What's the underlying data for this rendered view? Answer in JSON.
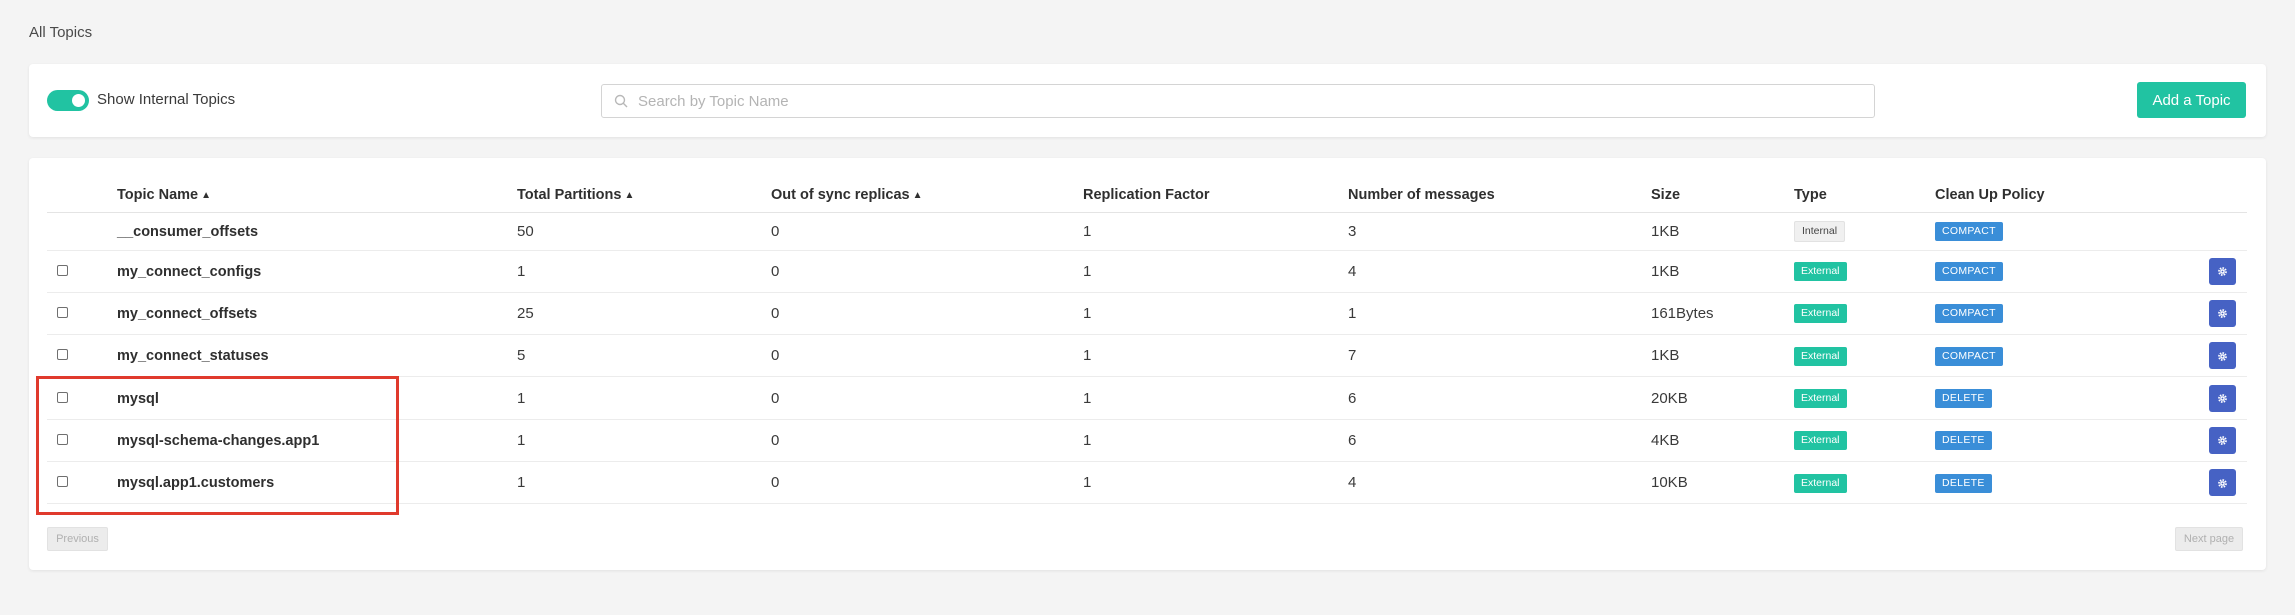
{
  "breadcrumb": "All Topics",
  "toolbar": {
    "toggle_label": "Show Internal Topics",
    "toggle_on": true,
    "search_placeholder": "Search by Topic Name",
    "search_value": "",
    "add_button_label": "Add a Topic"
  },
  "table": {
    "headers": {
      "topic_name": "Topic Name",
      "total_partitions": "Total Partitions",
      "out_of_sync": "Out of sync replicas",
      "replication_factor": "Replication Factor",
      "number_of_messages": "Number of messages",
      "size": "Size",
      "type": "Type",
      "clean_up_policy": "Clean Up Policy"
    },
    "rows": [
      {
        "name": "__consumer_offsets",
        "partitions": "50",
        "out_of_sync": "0",
        "replication_factor": "1",
        "messages": "3",
        "size": "1KB",
        "type": "Internal",
        "policy": "COMPACT"
      },
      {
        "name": "my_connect_configs",
        "partitions": "1",
        "out_of_sync": "0",
        "replication_factor": "1",
        "messages": "4",
        "size": "1KB",
        "type": "External",
        "policy": "COMPACT"
      },
      {
        "name": "my_connect_offsets",
        "partitions": "25",
        "out_of_sync": "0",
        "replication_factor": "1",
        "messages": "1",
        "size": "161Bytes",
        "type": "External",
        "policy": "COMPACT"
      },
      {
        "name": "my_connect_statuses",
        "partitions": "5",
        "out_of_sync": "0",
        "replication_factor": "1",
        "messages": "7",
        "size": "1KB",
        "type": "External",
        "policy": "COMPACT"
      },
      {
        "name": "mysql",
        "partitions": "1",
        "out_of_sync": "0",
        "replication_factor": "1",
        "messages": "6",
        "size": "20KB",
        "type": "External",
        "policy": "DELETE"
      },
      {
        "name": "mysql-schema-changes.app1",
        "partitions": "1",
        "out_of_sync": "0",
        "replication_factor": "1",
        "messages": "6",
        "size": "4KB",
        "type": "External",
        "policy": "DELETE"
      },
      {
        "name": "mysql.app1.customers",
        "partitions": "1",
        "out_of_sync": "0",
        "replication_factor": "1",
        "messages": "4",
        "size": "10KB",
        "type": "External",
        "policy": "DELETE"
      }
    ]
  },
  "pagination": {
    "previous_label": "Previous",
    "next_label": "Next page"
  },
  "colors": {
    "accent": "#21c3a2",
    "policy_badge": "#3a8ed8",
    "settings_button": "#4662c4",
    "highlight": "#e03a2d"
  }
}
